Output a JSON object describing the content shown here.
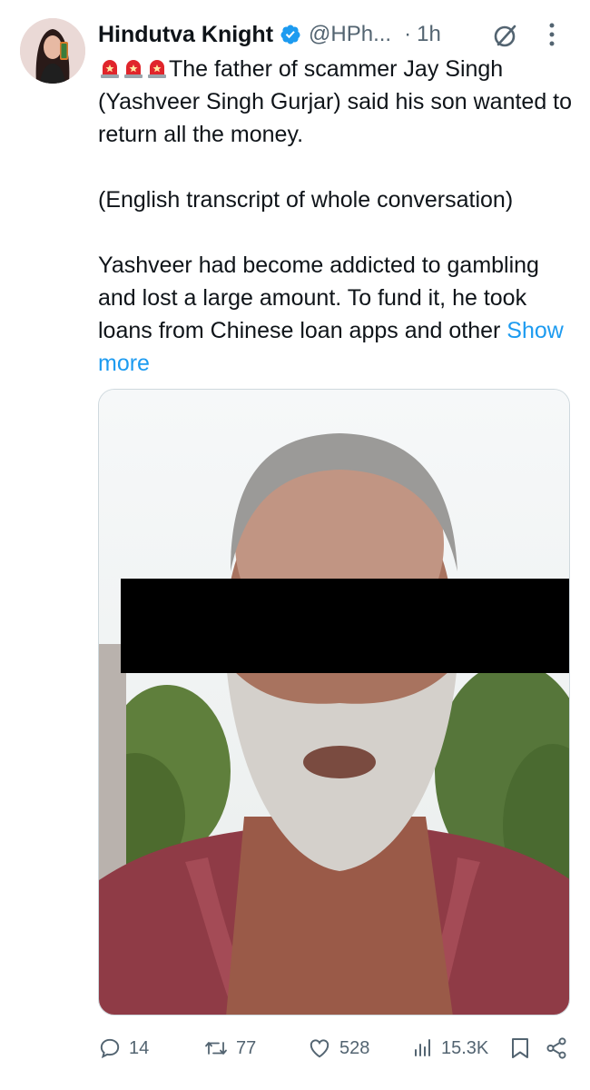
{
  "author": {
    "name": "Hindutva Knight",
    "handle": "@HPh...",
    "time": "1h",
    "verified": true
  },
  "tweet": {
    "line1": "The father of scammer Jay Singh (Yashveer Singh Gurjar) said his son wanted to return all the money.",
    "line2": "(English transcript of whole conversation)",
    "line3": "Yashveer had become addicted to gambling and lost a large amount. To fund it, he took loans from Chinese loan apps and other",
    "show_more": "Show more",
    "emoji": "siren-icon"
  },
  "media": {
    "icon": "photo",
    "censor_bar": true
  },
  "actions": {
    "replies": "14",
    "reposts": "77",
    "likes": "528",
    "views": "15.3K"
  },
  "colors": {
    "accent": "#1d9bf0",
    "text": "#0f1419",
    "muted": "#536471",
    "siren": "#e0252b"
  }
}
